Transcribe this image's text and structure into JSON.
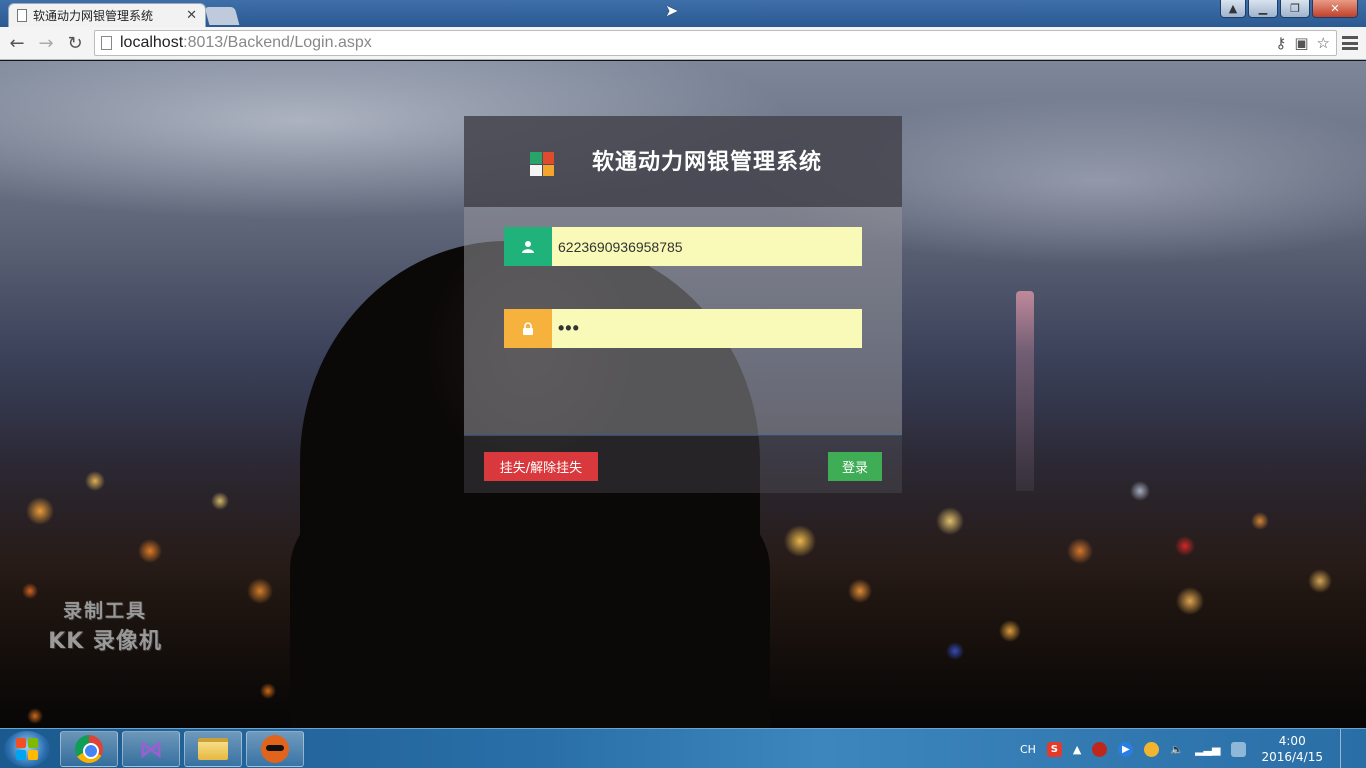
{
  "browser": {
    "tab_title": "软通动力网银管理系统",
    "url_host": "localhost",
    "url_rest": ":8013/Backend/Login.aspx"
  },
  "login": {
    "title": "软通动力网银管理系统",
    "username_value": "6223690936958785",
    "password_mask": "•••",
    "report_loss_label": "挂失/解除挂失",
    "login_label": "登录"
  },
  "watermark": {
    "line1": "录制工具",
    "line2": "KK 录像机"
  },
  "taskbar": {
    "ime": "CH",
    "time": "4:00",
    "date": "2016/4/15"
  },
  "colors": {
    "user_icon_bg": "#1fb27a",
    "lock_icon_bg": "#f7b13d",
    "input_bg": "#fafab8",
    "report_button": "#d9393c",
    "login_button": "#3fad55"
  },
  "icons": {
    "user": "user-icon",
    "lock": "lock-icon",
    "logo": "windows-logo-icon"
  }
}
